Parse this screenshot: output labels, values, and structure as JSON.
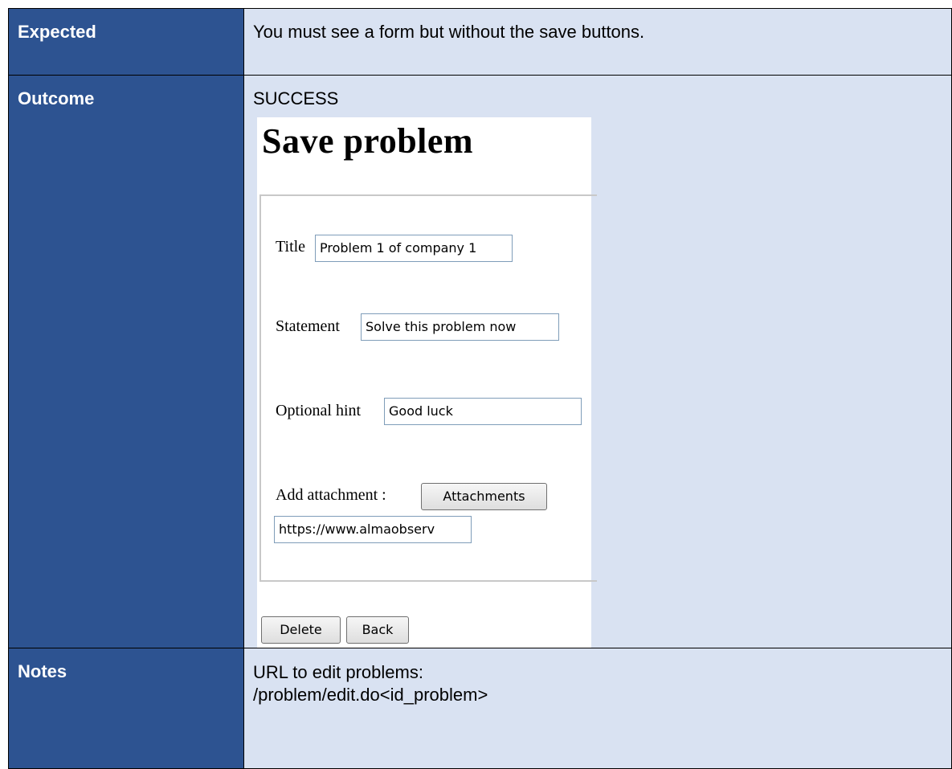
{
  "rows": {
    "expected": {
      "label": "Expected",
      "value": "You must see a form but without the save buttons."
    },
    "outcome": {
      "label": "Outcome",
      "value": "SUCCESS"
    },
    "notes": {
      "label": "Notes",
      "line1": "URL to edit problems:",
      "line2": "/problem/edit.do<id_problem>"
    }
  },
  "screenshot": {
    "heading": "Save problem",
    "title_label": "Title",
    "title_value": "Problem 1 of company 1",
    "statement_label": "Statement",
    "statement_value": "Solve this problem now",
    "hint_label": "Optional hint",
    "hint_value": "Good luck",
    "attachment_label": "Add attachment :",
    "attachments_button": "Attachments",
    "attachment_value": "https://www.almaobserv",
    "delete_button": "Delete",
    "back_button": "Back"
  },
  "colors": {
    "label_bg": "#2d5391",
    "value_bg": "#d9e2f2"
  }
}
